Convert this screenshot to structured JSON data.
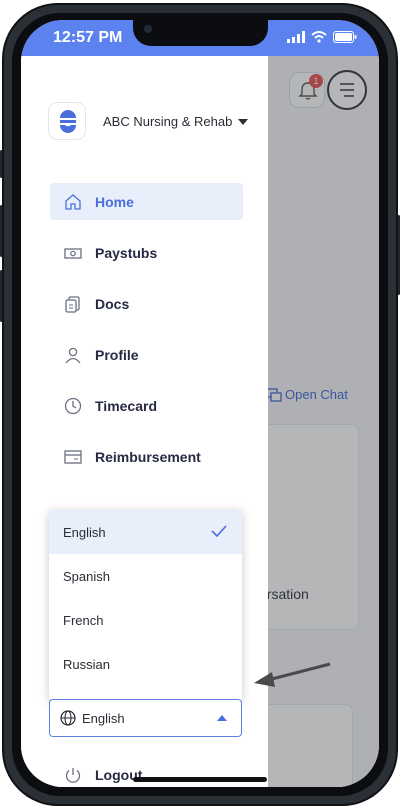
{
  "status_bar": {
    "time": "12:57 PM"
  },
  "header": {
    "notification_count": "1"
  },
  "drawer": {
    "facility_name": "ABC Nursing & Rehab",
    "nav": [
      {
        "label": "Home",
        "icon": "home-icon",
        "active": true
      },
      {
        "label": "Paystubs",
        "icon": "cash-icon"
      },
      {
        "label": "Docs",
        "icon": "documents-icon"
      },
      {
        "label": "Profile",
        "icon": "user-icon"
      },
      {
        "label": "Timecard",
        "icon": "clock-icon"
      },
      {
        "label": "Reimbursement",
        "icon": "receipt-icon"
      }
    ],
    "language_options": [
      "English",
      "Spanish",
      "French",
      "Russian"
    ],
    "selected_language": "English",
    "logout_label": "Logout"
  },
  "background": {
    "open_chat_label": "Open Chat",
    "conversation_fragment": "ersation"
  },
  "colors": {
    "accent": "#4a6fdc",
    "status_bar": "#5b82ee",
    "active_bg": "#e9eefb"
  }
}
